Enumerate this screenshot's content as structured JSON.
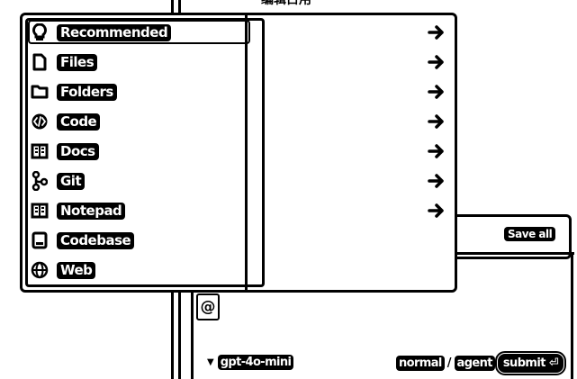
{
  "header": {
    "title": "编辑占用"
  },
  "toolbar": {
    "save_all_label": "Save all"
  },
  "menu": {
    "items": [
      {
        "label": "Recommended",
        "icon": "lightbulb-icon",
        "has_submenu": true
      },
      {
        "label": "Files",
        "icon": "file-icon",
        "has_submenu": true
      },
      {
        "label": "Folders",
        "icon": "folder-icon",
        "has_submenu": true
      },
      {
        "label": "Code",
        "icon": "code-icon",
        "has_submenu": true
      },
      {
        "label": "Docs",
        "icon": "book-icon",
        "has_submenu": true
      },
      {
        "label": "Git",
        "icon": "git-branch-icon",
        "has_submenu": true
      },
      {
        "label": "Notepad",
        "icon": "notepad-icon",
        "has_submenu": true
      },
      {
        "label": "Codebase",
        "icon": "codebase-icon",
        "has_submenu": false
      },
      {
        "label": "Web",
        "icon": "globe-icon",
        "has_submenu": false
      }
    ]
  },
  "composer": {
    "mention_symbol": "@",
    "model": "gpt-4o-mini",
    "mode_normal": "normal",
    "mode_separator": "/",
    "mode_agent": "agent",
    "submit_label": "submit ⏎"
  }
}
